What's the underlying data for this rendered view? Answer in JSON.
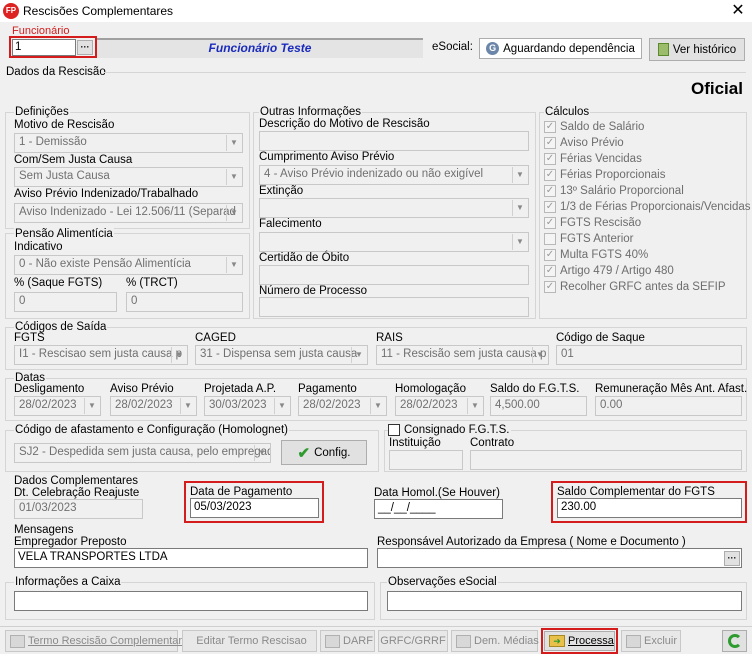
{
  "window": {
    "title": "Rescisões Complementares",
    "app_icon": "FP"
  },
  "funcionario": {
    "label": "Funcionário",
    "code": "1",
    "name": "Funcionário Teste"
  },
  "esocial": {
    "label": "eSocial:",
    "status_button": "Aguardando dependência",
    "history_button": "Ver histórico"
  },
  "dados_rescisao": {
    "label": "Dados da Rescisão",
    "tipo": "Oficial"
  },
  "definicoes": {
    "title": "Definições",
    "motivo_label": "Motivo de Rescisão",
    "motivo_value": "1 - Demissão",
    "justa_causa_label": "Com/Sem Justa Causa",
    "justa_causa_value": "Sem Justa Causa",
    "aviso_label": "Aviso Prévio Indenizado/Trabalhado",
    "aviso_value": "Aviso Indenizado - Lei 12.506/11 (Separad"
  },
  "pensao": {
    "title": "Pensão Alimentícia",
    "indicativo_label": "Indicativo",
    "indicativo_value": "0 - Não existe Pensão Alimentícia",
    "saque_fgts_label": "% (Saque FGTS)",
    "saque_fgts_value": "0",
    "trct_label": "% (TRCT)",
    "trct_value": "0"
  },
  "outras": {
    "title": "Outras Informações",
    "descricao_label": "Descrição do Motivo de Rescisão",
    "descricao_value": "",
    "cumprimento_label": "Cumprimento Aviso Prévio",
    "cumprimento_value": "4 - Aviso Prévio indenizado ou não exigível",
    "extincao_label": "Extinção",
    "extincao_value": "",
    "falecimento_label": "Falecimento",
    "falecimento_value": "",
    "certidao_label": "Certidão de Óbito",
    "certidao_value": "",
    "processo_label": "Número de Processo",
    "processo_value": ""
  },
  "calculos": {
    "title": "Cálculos",
    "items": [
      {
        "label": "Saldo de Salário",
        "checked": true
      },
      {
        "label": "Aviso Prévio",
        "checked": true
      },
      {
        "label": "Férias Vencidas",
        "checked": true
      },
      {
        "label": "Férias Proporcionais",
        "checked": true
      },
      {
        "label": "13º Salário Proporcional",
        "checked": true
      },
      {
        "label": "1/3 de Férias Proporcionais/Vencidas",
        "checked": true
      },
      {
        "label": "FGTS Rescisão",
        "checked": true
      },
      {
        "label": "FGTS Anterior",
        "checked": false
      },
      {
        "label": "Multa FGTS 40%",
        "checked": true
      },
      {
        "label": "Artigo 479 / Artigo 480",
        "checked": true
      },
      {
        "label": "Recolher GRFC antes da SEFIP",
        "checked": true
      }
    ]
  },
  "codigos_saida": {
    "title": "Códigos de Saída",
    "fgts_label": "FGTS",
    "fgts_value": "I1 - Rescisao sem justa causa p",
    "caged_label": "CAGED",
    "caged_value": "31  - Dispensa sem justa causa",
    "rais_label": "RAIS",
    "rais_value": "11 - Rescisão sem justa causa p",
    "saque_label": "Código de Saque",
    "saque_value": "01"
  },
  "datas": {
    "title": "Datas",
    "desligamento_label": "Desligamento",
    "desligamento_value": "28/02/2023",
    "aviso_label": "Aviso Prévio",
    "aviso_value": "28/02/2023",
    "projetada_label": "Projetada A.P.",
    "projetada_value": "30/03/2023",
    "pagamento_label": "Pagamento",
    "pagamento_value": "28/02/2023",
    "homologacao_label": "Homologação",
    "homologacao_value": "28/02/2023",
    "saldo_fgts_label": "Saldo do F.G.T.S.",
    "saldo_fgts_value": "4,500.00",
    "remuneracao_label": "Remuneração Mês Ant. Afast.",
    "remuneracao_value": "0.00"
  },
  "afastamento": {
    "title": "Código de afastamento e Configuração (Homolognet)",
    "value": "SJ2 - Despedida sem justa causa, pelo empregad",
    "config_button": "Config."
  },
  "consignado": {
    "label": "Consignado F.G.T.S.",
    "instituicao_label": "Instituição",
    "instituicao_value": "",
    "contrato_label": "Contrato",
    "contrato_value": ""
  },
  "complementares": {
    "title": "Dados Complementares",
    "celebracao_label": "Dt. Celebração Reajuste",
    "celebracao_value": "01/03/2023",
    "pagamento_label": "Data de Pagamento",
    "pagamento_value": "05/03/2023",
    "homol_label": "Data Homol.(Se Houver)",
    "homol_value": "__/__/____",
    "saldo_label": "Saldo Complementar do FGTS",
    "saldo_value": "230.00"
  },
  "mensagens": {
    "title": "Mensagens",
    "empregador_label": "Empregador Preposto",
    "empregador_value": "VELA TRANSPORTES LTDA",
    "responsavel_label": "Responsável Autorizado da Empresa ( Nome e Documento )",
    "responsavel_value": "",
    "caixa_label": "Informações a Caixa",
    "caixa_value": "",
    "obs_label": "Observações eSocial",
    "obs_value": ""
  },
  "toolbar": {
    "termo": "Termo Rescisão Complementar",
    "editar": "Editar Termo Rescisao",
    "darf": "DARF",
    "grfc": "GRFC/GRRF",
    "medias": "Dem. Médias",
    "processa": "Processa",
    "excluir": "Excluir"
  },
  "colors": {
    "highlight": "#d41c1c",
    "name_blue": "#1a2bbd"
  }
}
